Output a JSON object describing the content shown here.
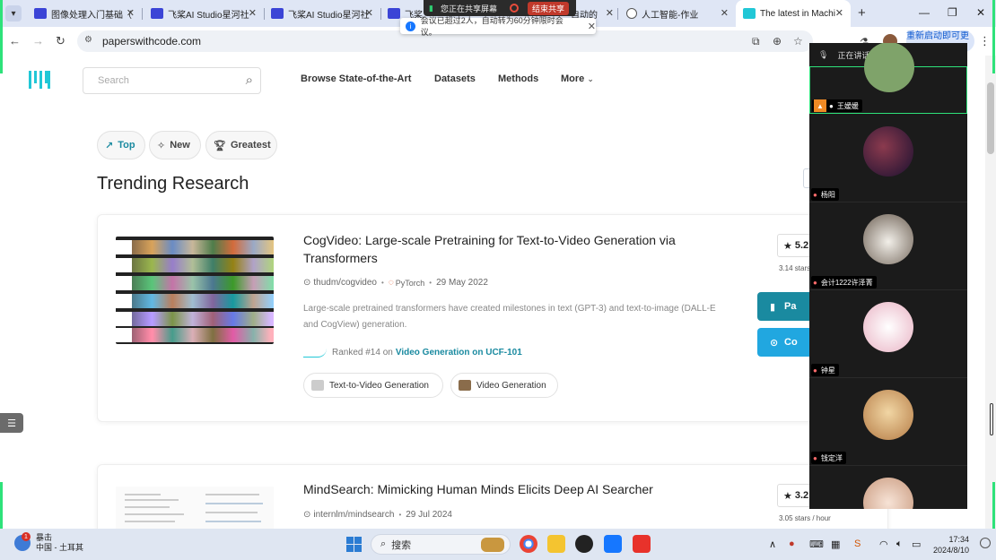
{
  "browser": {
    "tabs": [
      {
        "title": "图像处理入门基础（",
        "icon": "paddle-icon"
      },
      {
        "title": "飞桨AI Studio星河社",
        "icon": "paddle-icon"
      },
      {
        "title": "飞桨AI Studio星河社",
        "icon": "paddle-icon"
      },
      {
        "title": "飞桨AI",
        "icon": "paddle-icon"
      },
      {
        "title": "自动的",
        "icon": "paddle-icon"
      },
      {
        "title": "人工智能-作业",
        "icon": "globe-icon"
      },
      {
        "title": "The latest in Machi",
        "icon": "pwc-icon",
        "active": true
      }
    ],
    "url": "paperswithcode.com",
    "relaunch_label": "重新启动即可更新"
  },
  "share": {
    "status": "您正在共享屏幕",
    "stop_label": "结束共享",
    "notice": "会议已超过2人，自动转为60分钟限时会议。"
  },
  "site": {
    "search_placeholder": "Search",
    "nav": [
      "Browse State-of-the-Art",
      "Datasets",
      "Methods",
      "More"
    ],
    "filters": [
      {
        "label": "Top",
        "icon": "trend-icon",
        "active": true
      },
      {
        "label": "New",
        "icon": "sparkle-icon"
      },
      {
        "label": "Greatest",
        "icon": "trophy-icon"
      }
    ],
    "heading": "Trending Research",
    "papers": [
      {
        "title_line1": "CogVideo: Large-scale Pretraining for Text-to-Video Generation via",
        "title_line2": "Transformers",
        "repo": "thudm/cogvideo",
        "framework": "PyTorch",
        "date": "29 May 2022",
        "abstract_line1": "Large-scale pretrained transformers have created milestones in text (GPT-3) and text-to-image (DALL-E",
        "abstract_line2": "and CogView) generation.",
        "rank_prefix": "Ranked #14 on",
        "rank_link": "Video Generation on UCF-101",
        "tags": [
          "Text-to-Video Generation",
          "Video Generation"
        ],
        "stars": "5.2",
        "star_rate": "3.14 stars",
        "paper_btn": "Pa",
        "code_btn": "Co"
      },
      {
        "title_line1": "MindSearch: Mimicking Human Minds Elicits Deep AI Searcher",
        "repo": "internlm/mindsearch",
        "date": "29 Jul 2024",
        "stars": "3.2",
        "star_rate": "3.05 stars / hour"
      }
    ]
  },
  "meeting": {
    "speaking": "正在讲话：王嫒媛;",
    "participants": [
      {
        "name": "王嫒媛",
        "color": "#7fa36a"
      },
      {
        "name": "杨阳",
        "color": "#3b1d3f"
      },
      {
        "name": "会计1222许泽菁",
        "color": "#d7d2c9"
      },
      {
        "name": "钟星",
        "color": "#f0d7de"
      },
      {
        "name": "钱定洋",
        "color": "#d8b07a"
      },
      {
        "name": "",
        "color": "#e8c9b6"
      }
    ]
  },
  "taskbar": {
    "weather_title": "暴击",
    "weather_sub": "中国 - 土耳其",
    "badge": "1",
    "search_label": "搜索",
    "time": "17:34",
    "date": "2024/8/10"
  }
}
